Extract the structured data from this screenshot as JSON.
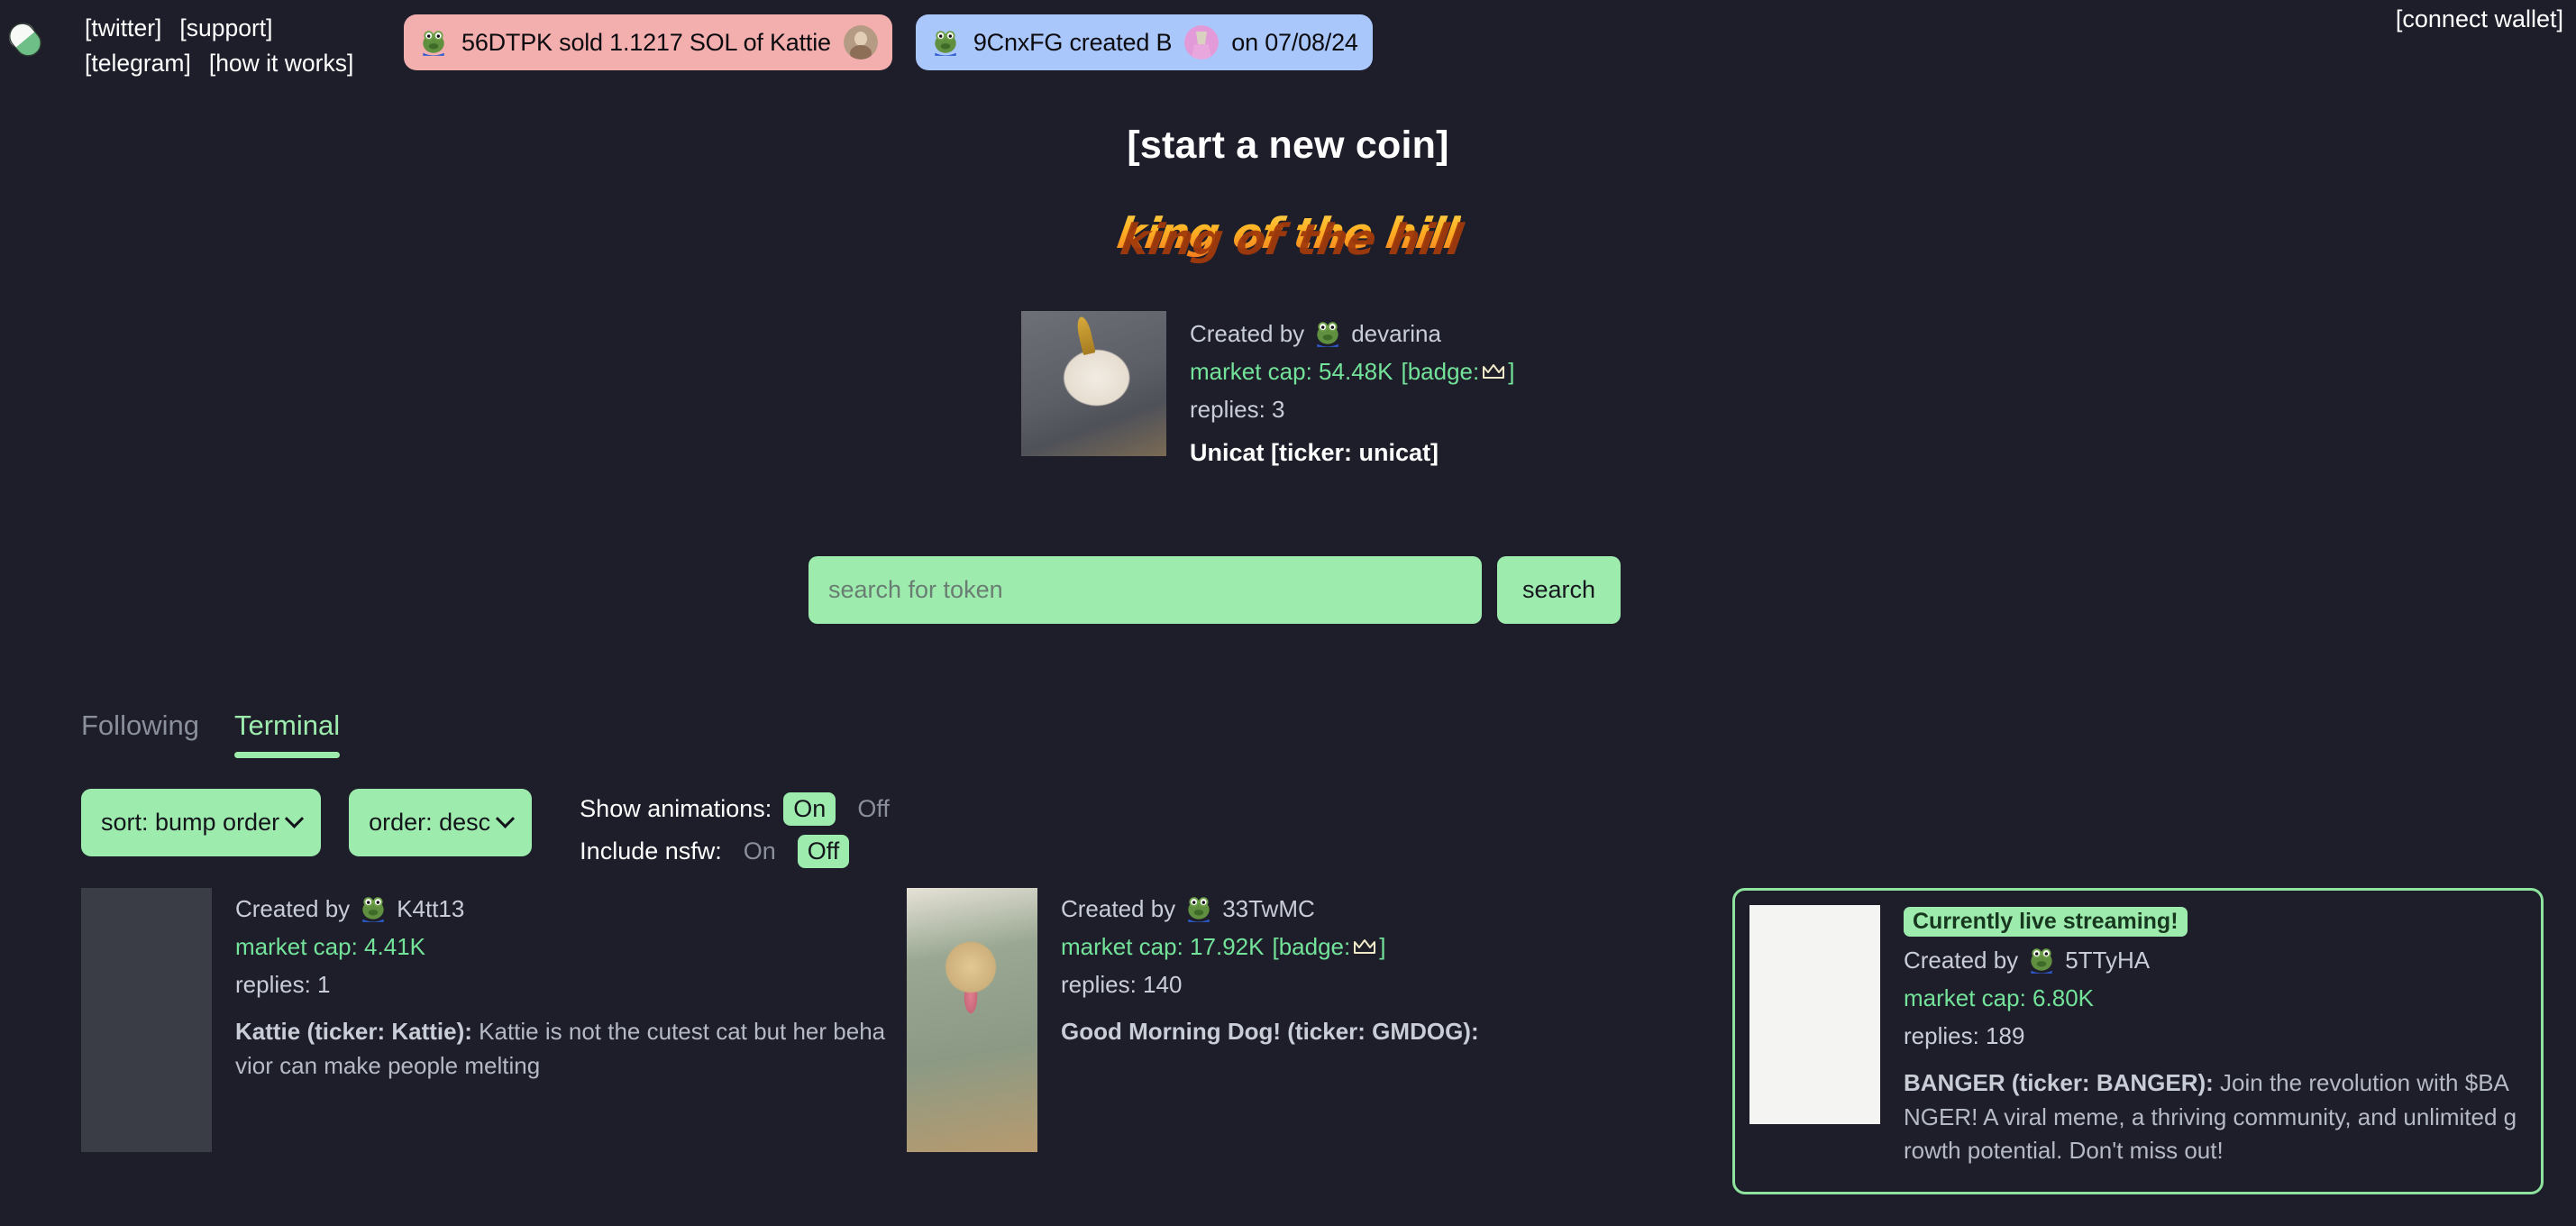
{
  "colors": {
    "background": "#1d1e2a",
    "mint": "#9debad",
    "mint_text": "#9debad",
    "pill_sold_bg": "#f3aeae",
    "pill_created_bg": "#aac7fb",
    "market_cap_green": "#74e39a",
    "muted": "#8b8f9c"
  },
  "topbar": {
    "logo_icon": "pill-capsule-icon",
    "nav_links": [
      "[twitter]",
      "[support]",
      "[telegram]",
      "[how it works]"
    ],
    "connect_wallet": "[connect wallet]",
    "pills": [
      {
        "type": "sold",
        "user": "56DTPK",
        "text": "sold 1.1217 SOL of Kattie",
        "full_text": "56DTPK  sold 1.1217 SOL of Kattie",
        "avatar_icon": "frog-avatar-icon",
        "thumb_icon": "coin-thumb-icon"
      },
      {
        "type": "created",
        "user": "9CnxFG",
        "text": "created B",
        "date": "on 07/08/24",
        "full_text": "9CnxFG created B",
        "avatar_icon": "frog-avatar-icon",
        "thumb_icon": "coin-thumb-icon"
      }
    ]
  },
  "hero": {
    "start_coin": "[start a new coin]",
    "king_of_the_hill": "king of the hill"
  },
  "koth_card": {
    "created_by_label": "Created by",
    "creator": "devarina",
    "market_cap": "market cap: 54.48K",
    "badge_open": "[badge:",
    "badge_close": "]",
    "badge_icon": "crown-icon",
    "replies": "replies: 3",
    "name": "Unicat [ticker: unicat]",
    "thumb_icon": "unicat-photo"
  },
  "search": {
    "placeholder": "search for token",
    "value": "",
    "button_label": "search"
  },
  "tabs": [
    {
      "label": "Following",
      "active": false
    },
    {
      "label": "Terminal",
      "active": true
    }
  ],
  "filters": {
    "sort": {
      "label": "sort: bump order",
      "chevron_icon": "chevron-down-icon"
    },
    "order": {
      "label": "order: desc",
      "chevron_icon": "chevron-down-icon"
    },
    "show_animations": {
      "label": "Show animations:",
      "on": "On",
      "off": "Off",
      "selected": "On"
    },
    "include_nsfw": {
      "label": "Include nsfw:",
      "on": "On",
      "off": "Off",
      "selected": "Off"
    }
  },
  "coins": [
    {
      "created_by_label": "Created by",
      "creator": "K4tt13",
      "market_cap": "market cap: 4.41K",
      "has_badge": false,
      "replies": "replies: 1",
      "title": "Kattie (ticker: Kattie):",
      "description": " Kattie is not the cutest cat but her behavior can make people melting",
      "thumb_icon": "kitten-photo",
      "live": false,
      "highlight": false
    },
    {
      "created_by_label": "Created by",
      "creator": "33TwMC",
      "market_cap": "market cap: 17.92K",
      "has_badge": true,
      "badge_open": "[badge:",
      "badge_close": "]",
      "badge_icon": "crown-icon",
      "replies": "replies: 140",
      "title": "Good Morning Dog! (ticker: GMDOG):",
      "description": "",
      "thumb_icon": "dog-photo",
      "live": false,
      "highlight": false
    },
    {
      "live_badge": "Currently live streaming!",
      "created_by_label": "Created by",
      "creator": "5TTyHA",
      "market_cap": "market cap: 6.80K",
      "has_badge": false,
      "replies": "replies: 189",
      "title": "BANGER (ticker: BANGER):",
      "description": " Join the revolution with $BANGER! A viral meme, a thriving community, and unlimited growth potential. Don't miss out!",
      "thumb_icon": "elephant-photo",
      "live": true,
      "highlight": true
    }
  ]
}
